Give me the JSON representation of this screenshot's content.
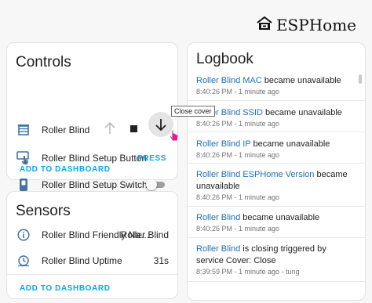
{
  "brand": {
    "title": "ESPHome"
  },
  "controls": {
    "title": "Controls",
    "rows": [
      {
        "label": "Roller Blind"
      },
      {
        "label": "Roller Blind Setup Button",
        "action": "PRESS"
      },
      {
        "label": "Roller Blind Setup Switch",
        "state": "off"
      }
    ],
    "add_to_dashboard": "ADD TO DASHBOARD",
    "tooltip": "Close cover"
  },
  "sensors": {
    "title": "Sensors",
    "rows": [
      {
        "label": "Roller Blind Friendly Na…",
        "value": "Roller Blind"
      },
      {
        "label": "Roller Blind Uptime",
        "value": "31s"
      }
    ],
    "add_to_dashboard": "ADD TO DASHBOARD"
  },
  "logbook": {
    "title": "Logbook",
    "entries": [
      {
        "entity": "Roller Blind MAC",
        "text": " became unavailable",
        "time": "8:40:26 PM - 1 minute ago"
      },
      {
        "entity": "Roller Blind SSID",
        "text": " became unavailable",
        "time": "8:40:26 PM - 1 minute ago"
      },
      {
        "entity": "Roller Blind IP",
        "text": " became unavailable",
        "time": "8:40:26 PM - 1 minute ago"
      },
      {
        "entity": "Roller Blind ESPHome Version",
        "text": " became unavailable",
        "time": "8:40:26 PM - 1 minute ago"
      },
      {
        "entity": "Roller Blind",
        "text": " became unavailable",
        "time": "8:40:26 PM - 1 minute ago"
      },
      {
        "entity": "Roller Blind",
        "text": " is closing triggered by service Cover: Close",
        "time": "8:39:59 PM - 1 minute ago - tung"
      }
    ]
  }
}
